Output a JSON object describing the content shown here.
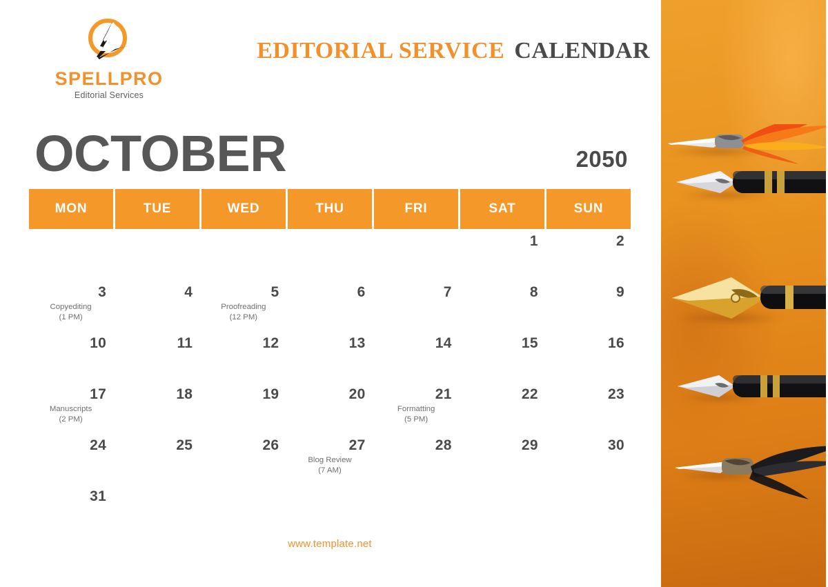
{
  "brand": {
    "logo_icon": "quill-pen-circle-logo",
    "name": "SPELLPRO",
    "tagline": "Editorial Services"
  },
  "header": {
    "title_accent": "EDITORIAL SERVICE",
    "title_main": "CALENDAR"
  },
  "calendar": {
    "month": "OCTOBER",
    "year": "2050",
    "weekdays": [
      "MON",
      "TUE",
      "WED",
      "THU",
      "FRI",
      "SAT",
      "SUN"
    ],
    "weeks": [
      [
        {
          "day": ""
        },
        {
          "day": ""
        },
        {
          "day": ""
        },
        {
          "day": ""
        },
        {
          "day": ""
        },
        {
          "day": "1"
        },
        {
          "day": "2"
        }
      ],
      [
        {
          "day": "3",
          "event": "Copyediting",
          "time": "(1 PM)"
        },
        {
          "day": "4"
        },
        {
          "day": "5",
          "event": "Proofreading",
          "time": "(12 PM)"
        },
        {
          "day": "6"
        },
        {
          "day": "7"
        },
        {
          "day": "8"
        },
        {
          "day": "9"
        }
      ],
      [
        {
          "day": "10"
        },
        {
          "day": "11"
        },
        {
          "day": "12"
        },
        {
          "day": "13"
        },
        {
          "day": "14"
        },
        {
          "day": "15"
        },
        {
          "day": "16"
        }
      ],
      [
        {
          "day": "17",
          "event": "Manuscripts",
          "time": "(2 PM)"
        },
        {
          "day": "18"
        },
        {
          "day": "19"
        },
        {
          "day": "20"
        },
        {
          "day": "21",
          "event": "Formatting",
          "time": "(5 PM)"
        },
        {
          "day": "22"
        },
        {
          "day": "23"
        }
      ],
      [
        {
          "day": "24"
        },
        {
          "day": "25"
        },
        {
          "day": "26"
        },
        {
          "day": "27",
          "event": "Blog Review",
          "time": "(7 AM)"
        },
        {
          "day": "28"
        },
        {
          "day": "29"
        },
        {
          "day": "30"
        }
      ],
      [
        {
          "day": "31"
        },
        {
          "day": ""
        },
        {
          "day": ""
        },
        {
          "day": ""
        },
        {
          "day": ""
        },
        {
          "day": ""
        },
        {
          "day": ""
        }
      ]
    ]
  },
  "footer": {
    "url": "www.template.net"
  },
  "photo": {
    "description": "fountain-pen-nibs-and-quills-on-orange-background"
  },
  "colors": {
    "orange": "#F5982A",
    "orange_text": "#F2912B",
    "cell_border": "#F5B264",
    "dark_text": "#4a4a4a",
    "event_text": "#6f6f6f"
  }
}
